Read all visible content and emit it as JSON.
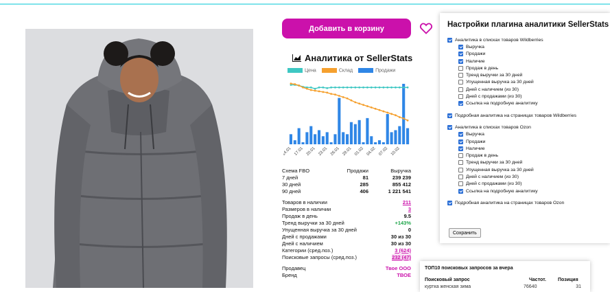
{
  "buttons": {
    "add_to_cart": "Добавить в корзину",
    "save": "Сохранить"
  },
  "analytics": {
    "title": "Аналитика от SellerStats",
    "legend": [
      "Цена",
      "Склад",
      "Продажи"
    ],
    "stats_header": [
      "Схема FBO",
      "Продажи",
      "Выручка"
    ],
    "stats_rows": [
      [
        "7 дней",
        "81",
        "239 239"
      ],
      [
        "30 дней",
        "285",
        "855 412"
      ],
      [
        "90 дней",
        "406",
        "1 221 541"
      ]
    ],
    "kv": [
      {
        "label": "Товаров в наличии",
        "value": "211"
      },
      {
        "label": "Размеров в наличии",
        "value": "3"
      },
      {
        "label": "Продаж в день",
        "value": "9.5"
      },
      {
        "label": "Тренд выручки за 30 дней",
        "value": "+143%"
      },
      {
        "label": "Упущенная выручка за 30 дней",
        "value": "0"
      },
      {
        "label": "Дней с продажами",
        "value": "30 из 30"
      },
      {
        "label": "Дней с наличием",
        "value": "30 из 30"
      },
      {
        "label": "Категории (сред.поз.)",
        "value": "3 (624)"
      },
      {
        "label": "Поисковые запросы (сред.поз.)",
        "value": "232 (47)"
      }
    ],
    "seller": {
      "label": "Продавец",
      "value": "Твое ООО"
    },
    "brand": {
      "label": "Бренд",
      "value": "ТВОЕ"
    }
  },
  "chart_data": {
    "type": "bar",
    "x": [
      "14.01",
      "15.01",
      "16.01",
      "17.01",
      "18.01",
      "19.01",
      "20.01",
      "21.01",
      "22.01",
      "23.01",
      "24.01",
      "25.01",
      "26.01",
      "27.01",
      "28.01",
      "29.01",
      "30.01",
      "31.01",
      "01.02",
      "02.02",
      "03.02",
      "04.02",
      "05.02",
      "06.02",
      "07.02",
      "08.02",
      "09.02",
      "10.02",
      "11.02",
      "12.02"
    ],
    "tick_labels": [
      "14.01",
      "17.01",
      "20.01",
      "23.01",
      "26.01",
      "29.01",
      "01.02",
      "04.02",
      "07.02",
      "10.02"
    ],
    "series": [
      {
        "name": "Продажи",
        "kind": "bar",
        "values": [
          5,
          2,
          8,
          1,
          6,
          9,
          5,
          7,
          4,
          6,
          1,
          5,
          23,
          6,
          5,
          11,
          10,
          12,
          1,
          13,
          4,
          1,
          2,
          1,
          15,
          6,
          7,
          9,
          30,
          8
        ]
      },
      {
        "name": "Цена",
        "kind": "line",
        "values": [
          92,
          92,
          91,
          89,
          88,
          88,
          86,
          88,
          88,
          87,
          88,
          88,
          88,
          88,
          88,
          88,
          88,
          88,
          88,
          88,
          88,
          88,
          88,
          88,
          88,
          88,
          88,
          88,
          88,
          88
        ]
      },
      {
        "name": "Склад",
        "kind": "line",
        "values": [
          94,
          93,
          91,
          88,
          86,
          84,
          83,
          82,
          81,
          80,
          78,
          77,
          75,
          73,
          71,
          68,
          65,
          63,
          61,
          59,
          57,
          55,
          53,
          51,
          49,
          47,
          45,
          42,
          40,
          37
        ]
      }
    ],
    "ylim": [
      0,
      100
    ],
    "colors": {
      "Цена": "#3ec7c3",
      "Склад": "#f5a02e",
      "Продажи": "#2f86e6"
    }
  },
  "settings": {
    "title": "Настройки плагина аналитики SellerStats",
    "options": [
      {
        "label": "Аналитика в списках товаров Wildberries",
        "checked": true,
        "level": 0
      },
      {
        "label": "Выручка",
        "checked": true,
        "level": 1
      },
      {
        "label": "Продажи",
        "checked": true,
        "level": 1
      },
      {
        "label": "Наличие",
        "checked": true,
        "level": 1
      },
      {
        "label": "Продаж в день",
        "checked": false,
        "level": 1
      },
      {
        "label": "Тренд выручки за 30 дней",
        "checked": false,
        "level": 1
      },
      {
        "label": "Упущенная выручка за 30 дней",
        "checked": false,
        "level": 1
      },
      {
        "label": "Дней с наличием (из 30)",
        "checked": false,
        "level": 1
      },
      {
        "label": "Дней с продажами (из 30)",
        "checked": false,
        "level": 1
      },
      {
        "label": "Ссылка на подробную аналитику",
        "checked": true,
        "level": 1
      },
      {
        "label": "Подробная аналитика на страницах товаров Wildberries",
        "checked": true,
        "level": 0,
        "gap": true
      },
      {
        "label": "Аналитика в списках товаров Ozon",
        "checked": true,
        "level": 0,
        "gap": true
      },
      {
        "label": "Выручка",
        "checked": true,
        "level": 1
      },
      {
        "label": "Продажи",
        "checked": true,
        "level": 1
      },
      {
        "label": "Наличие",
        "checked": true,
        "level": 1
      },
      {
        "label": "Продаж в день",
        "checked": false,
        "level": 1
      },
      {
        "label": "Тренд выручки за 30 дней",
        "checked": false,
        "level": 1
      },
      {
        "label": "Упущенная выручка за 30 дней",
        "checked": false,
        "level": 1
      },
      {
        "label": "Дней с наличием (из 30)",
        "checked": false,
        "level": 1
      },
      {
        "label": "Дней с продажами (из 30)",
        "checked": false,
        "level": 1
      },
      {
        "label": "Ссылка на подробную аналитику",
        "checked": true,
        "level": 1
      },
      {
        "label": "Подробная аналитика на страницах товаров Ozon",
        "checked": true,
        "level": 0,
        "gap": true
      }
    ]
  },
  "top10": {
    "title": "ТОП10 поисковых запросов за вчера",
    "headers": [
      "Поисковый запрос",
      "Частот.",
      "Позиция"
    ],
    "rows": [
      [
        "куртка женская зима",
        "76640",
        "31"
      ]
    ]
  }
}
